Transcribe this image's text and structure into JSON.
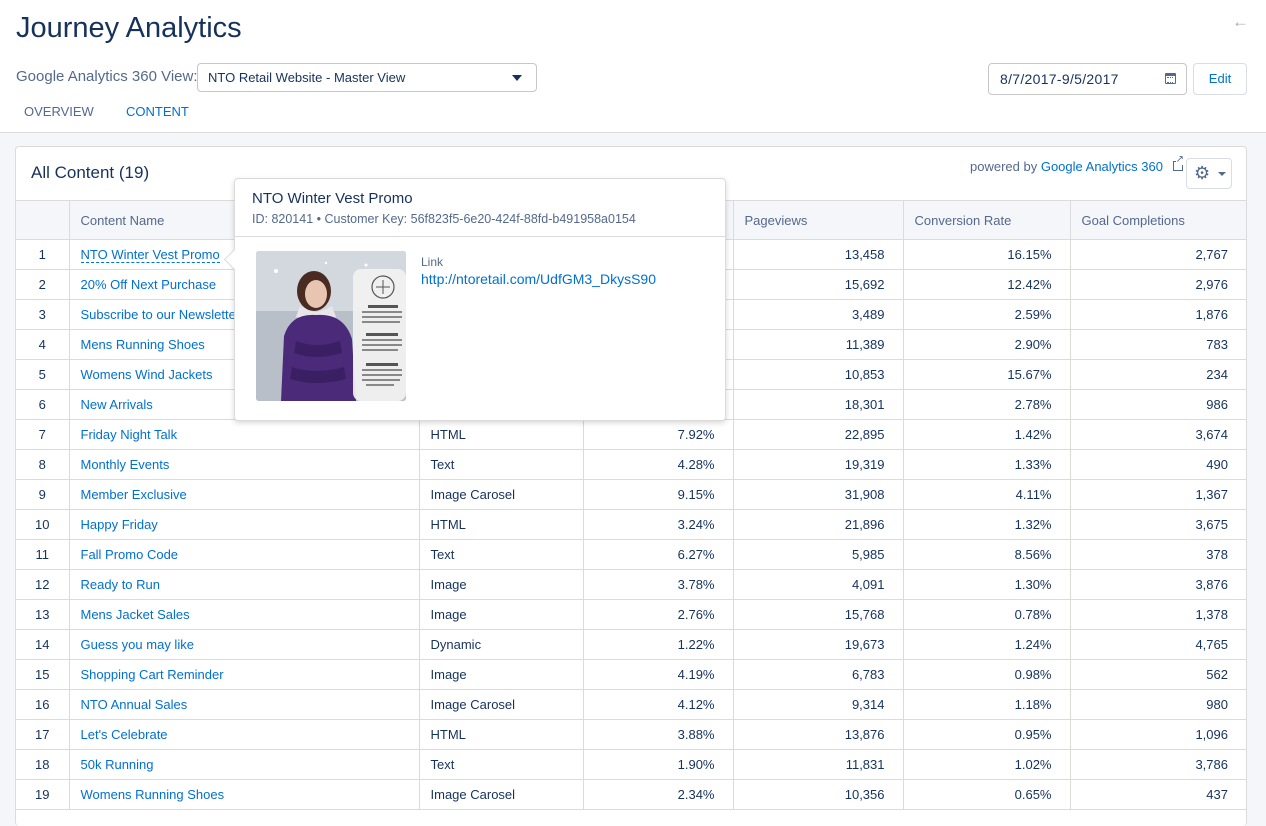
{
  "header": {
    "title": "Journey Analytics",
    "view_label": "Google Analytics 360 View:",
    "view_value": "NTO Retail Website - Master View",
    "date_range": "8/7/2017-9/5/2017",
    "edit_label": "Edit"
  },
  "tabs": [
    {
      "label": "OVERVIEW",
      "active": false
    },
    {
      "label": "CONTENT",
      "active": true
    }
  ],
  "card": {
    "title": "All Content (19)",
    "powered_prefix": "powered by",
    "powered_link": "Google Analytics 360"
  },
  "table": {
    "columns": [
      "",
      "Content Name",
      "",
      "",
      "Pageviews",
      "Conversion Rate",
      "Goal Completions"
    ],
    "rows": [
      {
        "n": "1",
        "name": "NTO Winter Vest Promo",
        "type": "",
        "rate": "",
        "pageviews": "13,458",
        "conversion": "16.15%",
        "goals": "2,767"
      },
      {
        "n": "2",
        "name": "20% Off Next Purchase",
        "type": "",
        "rate": "",
        "pageviews": "15,692",
        "conversion": "12.42%",
        "goals": "2,976"
      },
      {
        "n": "3",
        "name": "Subscribe to our Newsletter",
        "type": "",
        "rate": "",
        "pageviews": "3,489",
        "conversion": "2.59%",
        "goals": "1,876"
      },
      {
        "n": "4",
        "name": "Mens Running Shoes",
        "type": "",
        "rate": "",
        "pageviews": "11,389",
        "conversion": "2.90%",
        "goals": "783"
      },
      {
        "n": "5",
        "name": "Womens Wind Jackets",
        "type": "",
        "rate": "",
        "pageviews": "10,853",
        "conversion": "15.67%",
        "goals": "234"
      },
      {
        "n": "6",
        "name": "New Arrivals",
        "type": "",
        "rate": "",
        "pageviews": "18,301",
        "conversion": "2.78%",
        "goals": "986"
      },
      {
        "n": "7",
        "name": "Friday Night Talk",
        "type": "HTML",
        "rate": "7.92%",
        "pageviews": "22,895",
        "conversion": "1.42%",
        "goals": "3,674"
      },
      {
        "n": "8",
        "name": "Monthly Events",
        "type": "Text",
        "rate": "4.28%",
        "pageviews": "19,319",
        "conversion": "1.33%",
        "goals": "490"
      },
      {
        "n": "9",
        "name": "Member Exclusive",
        "type": "Image Carosel",
        "rate": "9.15%",
        "pageviews": "31,908",
        "conversion": "4.11%",
        "goals": "1,367"
      },
      {
        "n": "10",
        "name": "Happy Friday",
        "type": "HTML",
        "rate": "3.24%",
        "pageviews": "21,896",
        "conversion": "1.32%",
        "goals": "3,675"
      },
      {
        "n": "11",
        "name": "Fall Promo Code",
        "type": "Text",
        "rate": "6.27%",
        "pageviews": "5,985",
        "conversion": "8.56%",
        "goals": "378"
      },
      {
        "n": "12",
        "name": "Ready to Run",
        "type": "Image",
        "rate": "3.78%",
        "pageviews": "4,091",
        "conversion": "1.30%",
        "goals": "3,876"
      },
      {
        "n": "13",
        "name": "Mens Jacket Sales",
        "type": "Image",
        "rate": "2.76%",
        "pageviews": "15,768",
        "conversion": "0.78%",
        "goals": "1,378"
      },
      {
        "n": "14",
        "name": "Guess you may like",
        "type": "Dynamic",
        "rate": "1.22%",
        "pageviews": "19,673",
        "conversion": "1.24%",
        "goals": "4,765"
      },
      {
        "n": "15",
        "name": "Shopping Cart Reminder",
        "type": "Image",
        "rate": "4.19%",
        "pageviews": "6,783",
        "conversion": "0.98%",
        "goals": "562"
      },
      {
        "n": "16",
        "name": "NTO Annual Sales",
        "type": "Image Carosel",
        "rate": "4.12%",
        "pageviews": "9,314",
        "conversion": "1.18%",
        "goals": "980"
      },
      {
        "n": "17",
        "name": "Let's Celebrate",
        "type": "HTML",
        "rate": "3.88%",
        "pageviews": "13,876",
        "conversion": "0.95%",
        "goals": "1,096"
      },
      {
        "n": "18",
        "name": "50k Running",
        "type": "Text",
        "rate": "1.90%",
        "pageviews": "11,831",
        "conversion": "1.02%",
        "goals": "3,786"
      },
      {
        "n": "19",
        "name": "Womens Running Shoes",
        "type": "Image Carosel",
        "rate": "2.34%",
        "pageviews": "10,356",
        "conversion": "0.65%",
        "goals": "437"
      }
    ]
  },
  "popover": {
    "title": "NTO Winter Vest Promo",
    "subtitle": "ID: 820141 • Customer Key: 56f823f5-6e20-424f-88fd-b491958a0154",
    "link_label": "Link",
    "link_url": "http://ntoretail.com/UdfGM3_DkysS90"
  },
  "colors": {
    "brand_blue": "#0070d2",
    "text_dark": "#16325c",
    "text_muted": "#54698d"
  }
}
